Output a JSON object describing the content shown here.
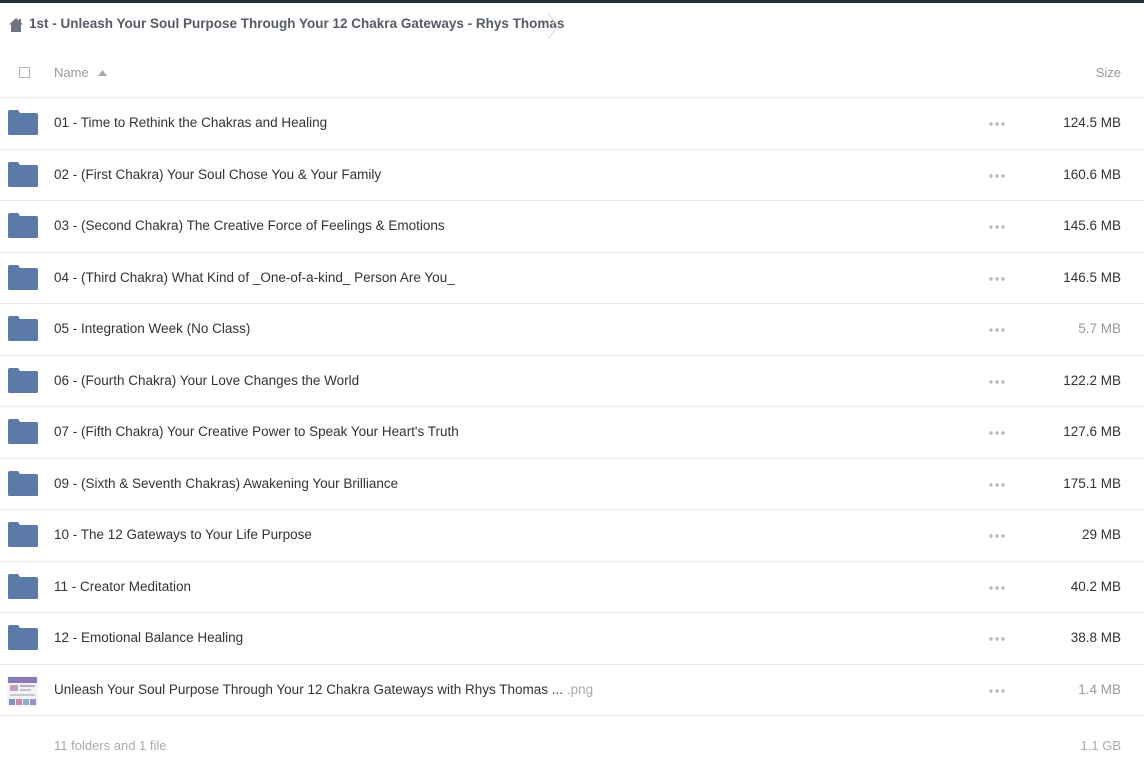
{
  "breadcrumb": {
    "title": "1st - Unleash Your Soul Purpose Through Your 12 Chakra Gateways - Rhys Thomas",
    "home_icon": "home-icon"
  },
  "header": {
    "name_label": "Name",
    "size_label": "Size",
    "sort": "ascending"
  },
  "colors": {
    "folder": "#5b7aa8",
    "top_bar": "#262d3d",
    "muted_text": "#999999"
  },
  "rows": [
    {
      "type": "folder",
      "name": "01 - Time to Rethink the Chakras and Healing",
      "size": "124.5 MB",
      "muted": false
    },
    {
      "type": "folder",
      "name": "02 - (First Chakra) Your Soul Chose You & Your Family",
      "size": "160.6 MB",
      "muted": false
    },
    {
      "type": "folder",
      "name": "03 - (Second Chakra) The Creative Force of Feelings & Emotions",
      "size": "145.6 MB",
      "muted": false
    },
    {
      "type": "folder",
      "name": "04 - (Third Chakra) What Kind of _One-of-a-kind_ Person Are You_",
      "size": "146.5 MB",
      "muted": false
    },
    {
      "type": "folder",
      "name": "05 - Integration Week (No Class)",
      "size": "5.7 MB",
      "muted": true
    },
    {
      "type": "folder",
      "name": "06 - (Fourth Chakra) Your Love Changes the World",
      "size": "122.2 MB",
      "muted": false
    },
    {
      "type": "folder",
      "name": "07 - (Fifth Chakra) Your Creative Power to Speak Your Heart's Truth",
      "size": "127.6 MB",
      "muted": false
    },
    {
      "type": "folder",
      "name": "09 - (Sixth & Seventh Chakras) Awakening Your Brilliance",
      "size": "175.1 MB",
      "muted": false
    },
    {
      "type": "folder",
      "name": "10 - The 12 Gateways to Your Life Purpose",
      "size": "29 MB",
      "muted": false
    },
    {
      "type": "folder",
      "name": "11 - Creator Meditation",
      "size": "40.2 MB",
      "muted": false
    },
    {
      "type": "folder",
      "name": "12 - Emotional Balance Healing",
      "size": "38.8 MB",
      "muted": false
    },
    {
      "type": "file",
      "name": "Unleash Your Soul Purpose Through Your 12 Chakra Gateways with Rhys Thomas ...",
      "ext": ".png",
      "size": "1.4 MB",
      "muted": true
    }
  ],
  "footer": {
    "summary": "11 folders and 1 file",
    "total": "1.1 GB"
  }
}
